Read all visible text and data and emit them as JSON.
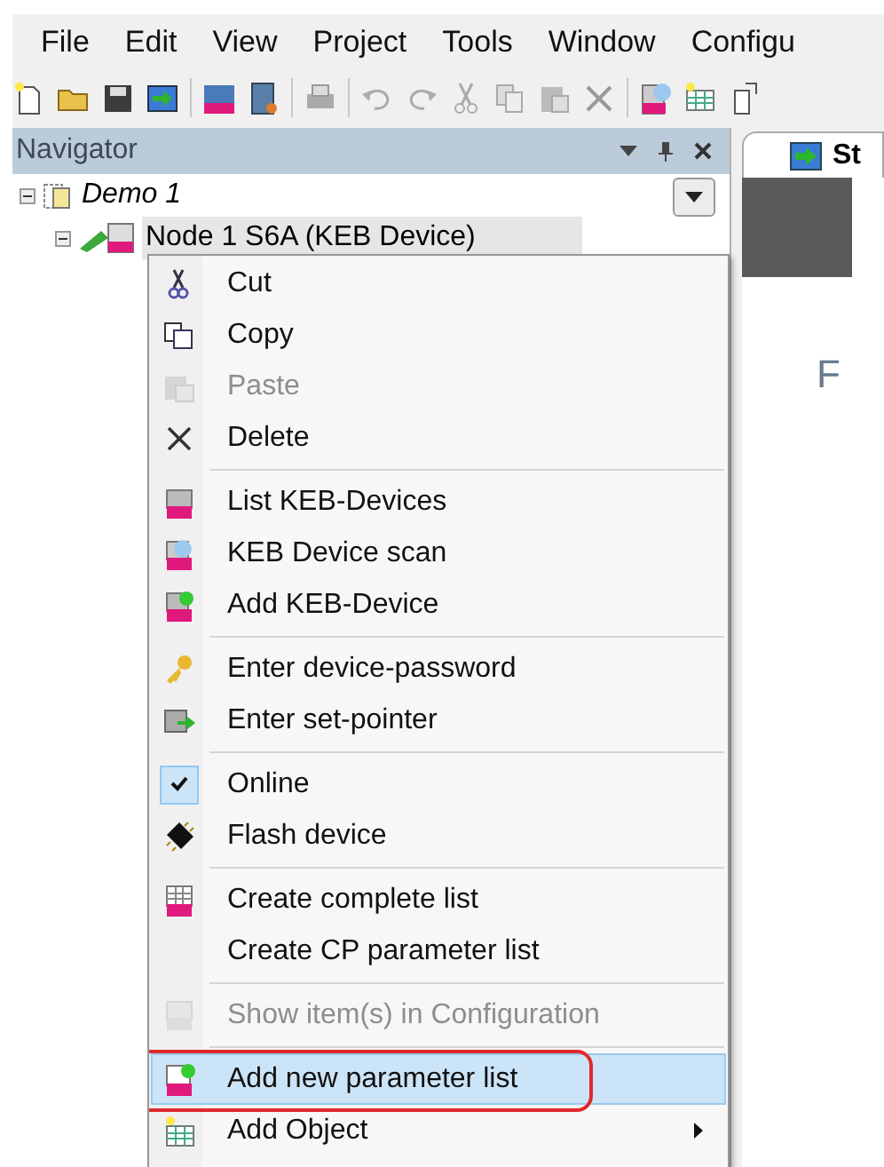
{
  "menu_bar": [
    {
      "label": "File"
    },
    {
      "label": "Edit"
    },
    {
      "label": "View"
    },
    {
      "label": "Project"
    },
    {
      "label": "Tools"
    },
    {
      "label": "Window"
    },
    {
      "label": "Configu"
    }
  ],
  "navigator": {
    "title": "Navigator",
    "tree": [
      {
        "label": "Demo 1",
        "expanded": true,
        "children": [
          {
            "label": "Node  1  S6A (KEB Device)",
            "expanded": true,
            "selected": true
          }
        ]
      }
    ]
  },
  "document_tab": {
    "label": "St"
  },
  "document_text": "F",
  "context_menu": [
    {
      "kind": "item",
      "label": "Cut",
      "disabled": false,
      "checked": false,
      "selected": false,
      "submenu": false
    },
    {
      "kind": "item",
      "label": "Copy",
      "disabled": false,
      "checked": false,
      "selected": false,
      "submenu": false
    },
    {
      "kind": "item",
      "label": "Paste",
      "disabled": true,
      "checked": false,
      "selected": false,
      "submenu": false
    },
    {
      "kind": "item",
      "label": "Delete",
      "disabled": false,
      "checked": false,
      "selected": false,
      "submenu": false
    },
    {
      "kind": "separator"
    },
    {
      "kind": "item",
      "label": "List KEB-Devices",
      "disabled": false,
      "checked": false,
      "selected": false,
      "submenu": false
    },
    {
      "kind": "item",
      "label": "KEB Device scan",
      "disabled": false,
      "checked": false,
      "selected": false,
      "submenu": false
    },
    {
      "kind": "item",
      "label": "Add KEB-Device",
      "disabled": false,
      "checked": false,
      "selected": false,
      "submenu": false
    },
    {
      "kind": "separator"
    },
    {
      "kind": "item",
      "label": "Enter device-password",
      "disabled": false,
      "checked": false,
      "selected": false,
      "submenu": false
    },
    {
      "kind": "item",
      "label": "Enter set-pointer",
      "disabled": false,
      "checked": false,
      "selected": false,
      "submenu": false
    },
    {
      "kind": "separator"
    },
    {
      "kind": "item",
      "label": "Online",
      "disabled": false,
      "checked": true,
      "selected": false,
      "submenu": false
    },
    {
      "kind": "item",
      "label": "Flash device",
      "disabled": false,
      "checked": false,
      "selected": false,
      "submenu": false
    },
    {
      "kind": "separator"
    },
    {
      "kind": "item",
      "label": "Create complete list",
      "disabled": false,
      "checked": false,
      "selected": false,
      "submenu": false
    },
    {
      "kind": "item",
      "label": "Create CP parameter list",
      "disabled": false,
      "checked": false,
      "selected": false,
      "submenu": false
    },
    {
      "kind": "separator"
    },
    {
      "kind": "item",
      "label": "Show item(s) in Configuration",
      "disabled": true,
      "checked": false,
      "selected": false,
      "submenu": false
    },
    {
      "kind": "separator"
    },
    {
      "kind": "item",
      "label": "Add new parameter list",
      "disabled": false,
      "checked": false,
      "selected": true,
      "submenu": false
    },
    {
      "kind": "item",
      "label": "Add Object",
      "disabled": false,
      "checked": false,
      "selected": false,
      "submenu": true
    }
  ]
}
